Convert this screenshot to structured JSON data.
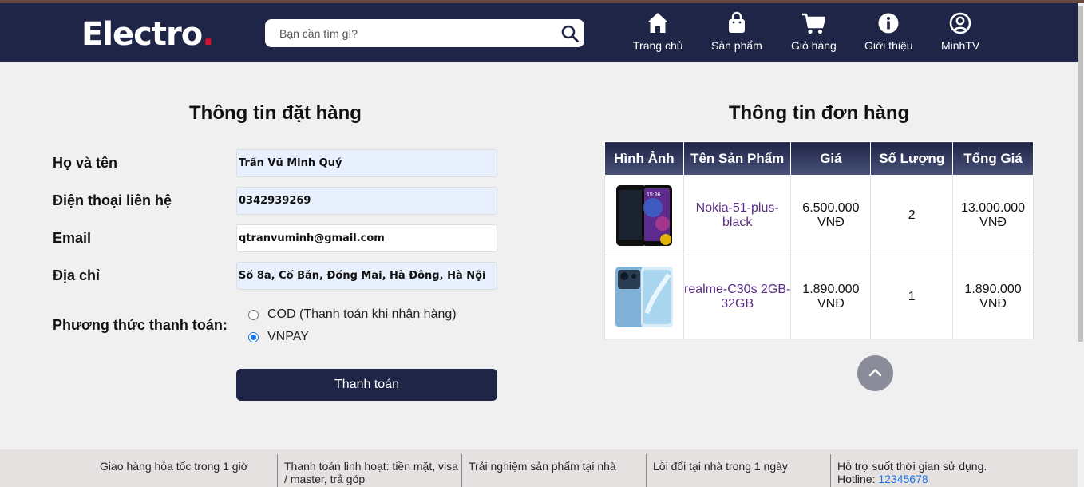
{
  "header": {
    "logo_text": "Electro",
    "logo_dot": ".",
    "search_placeholder": "Bạn cần tìm gì?",
    "nav": [
      {
        "label": "Trang chủ",
        "icon": "home-icon"
      },
      {
        "label": "Sản phẩm",
        "icon": "shopping-bag-icon"
      },
      {
        "label": "Giỏ hàng",
        "icon": "cart-icon"
      },
      {
        "label": "Giới thiệu",
        "icon": "info-icon"
      },
      {
        "label": "MinhTV",
        "icon": "user-circle-icon"
      }
    ]
  },
  "order_form": {
    "title": "Thông tin đặt hàng",
    "name_label": "Họ và tên",
    "name_value": "Trần Vũ Minh Quý",
    "phone_label": "Điện thoại liên hệ",
    "phone_value": "0342939269",
    "email_label": "Email",
    "email_value": "qtranvuminh@gmail.com",
    "address_label": "Địa chỉ",
    "address_value": "Số 8a, Cổ Bản, Đồng Mai, Hà Đông, Hà Nội",
    "payment_label": "Phương thức thanh toán:",
    "payment_options": [
      "COD (Thanh toán khi nhận hàng)",
      "VNPAY"
    ],
    "payment_selected": "VNPAY",
    "submit_label": "Thanh toán"
  },
  "order_summary": {
    "title": "Thông tin đơn hàng",
    "columns": [
      "Hình Ảnh",
      "Tên Sản Phẩm",
      "Giá",
      "Số Lượng",
      "Tổng Giá"
    ],
    "rows": [
      {
        "image": "nokia-phone-image",
        "name": "Nokia-51-plus-black",
        "price": "6.500.000 VNĐ",
        "qty": "2",
        "total": "13.000.000 VNĐ"
      },
      {
        "image": "realme-phone-image",
        "name": "realme-C30s 2GB-32GB",
        "price": "1.890.000 VNĐ",
        "qty": "1",
        "total": "1.890.000 VNĐ"
      }
    ]
  },
  "footer": {
    "items": [
      "Giao hàng hỏa tốc trong 1 giờ",
      "Thanh toán linh hoạt: tiền mặt, visa / master, trả góp",
      "Trải nghiệm sản phẩm tại nhà",
      "Lỗi đổi tại nhà trong 1 ngày"
    ],
    "support_text": "Hỗ trợ suốt thời gian sử dụng.",
    "hotline_label": "Hotline:",
    "hotline_number": "12345678"
  },
  "colors": {
    "header_bg": "#1f2547",
    "logo_dot": "#d6112d",
    "link": "#1a73e8",
    "product_name": "#5a2d82"
  }
}
